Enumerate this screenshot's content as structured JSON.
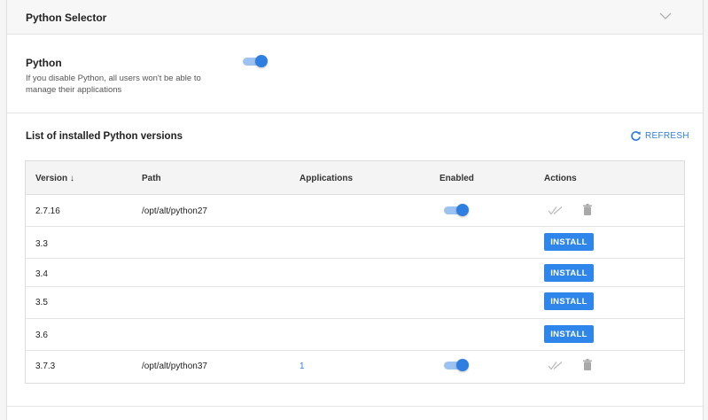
{
  "header": {
    "title": "Python Selector"
  },
  "python": {
    "label": "Python",
    "description": "If you disable Python, all users won't be able to manage their applications",
    "enabled": true
  },
  "list": {
    "title": "List of installed Python versions",
    "refresh_label": "REFRESH"
  },
  "table": {
    "columns": {
      "version": "Version ↓",
      "path": "Path",
      "applications": "Applications",
      "enabled": "Enabled",
      "actions": "Actions"
    },
    "install_label": "INSTALL",
    "rows": [
      {
        "version": "2.7.16",
        "path": "/opt/alt/python27",
        "applications": "",
        "installed": true,
        "enabled": true
      },
      {
        "version": "3.3",
        "path": "",
        "applications": "",
        "installed": false
      },
      {
        "version": "3.4",
        "path": "",
        "applications": "",
        "installed": false
      },
      {
        "version": "3.5",
        "path": "",
        "applications": "",
        "installed": false
      },
      {
        "version": "3.6",
        "path": "",
        "applications": "",
        "installed": false
      },
      {
        "version": "3.7.3",
        "path": "/opt/alt/python37",
        "applications": "1",
        "installed": true,
        "enabled": true
      }
    ]
  },
  "colors": {
    "accent": "#2f86ea",
    "toggle_track": "#9cc2f2",
    "toggle_knob": "#2f7fe0"
  }
}
